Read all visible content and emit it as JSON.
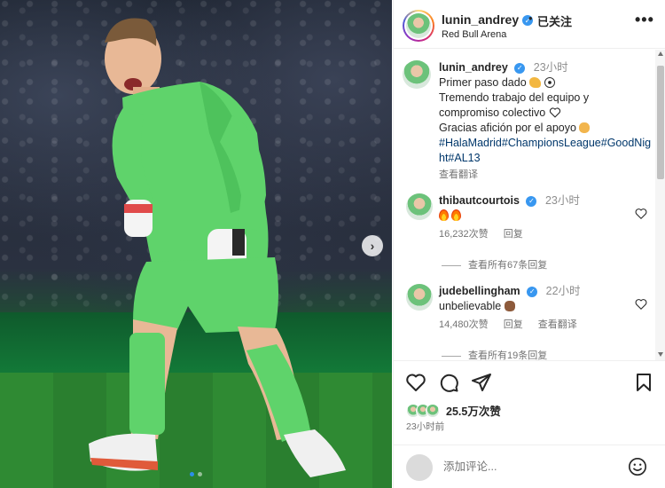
{
  "post": {
    "author": "lunin_andrey",
    "follow_label": "已关注",
    "separator": "•",
    "location": "Red Bull Arena",
    "more_label": "•••"
  },
  "caption": {
    "author": "lunin_andrey",
    "time": "23小时",
    "line1": "Primer paso dado",
    "line2": "Tremendo trabajo del equipo y compromiso colectivo",
    "line3": "Gracias afición por el apoyo",
    "hashtags": "#HalaMadrid#ChampionsLeague#GoodNight#AL13",
    "see_translation": "查看翻译"
  },
  "comments": [
    {
      "author": "thibautcourtois",
      "time": "23小时",
      "likes": "16,232次赞",
      "reply": "回复",
      "view_replies": "查看所有67条回复"
    },
    {
      "author": "judebellingham",
      "time": "22小时",
      "text": "unbelievable",
      "likes": "14,480次赞",
      "reply": "回复",
      "see_translation": "查看翻译",
      "view_replies": "查看所有19条回复"
    }
  ],
  "actions": {
    "likes_count": "25.5万次赞",
    "post_time": "23小时前"
  },
  "composer": {
    "placeholder": "添加评论..."
  },
  "colors": {
    "link": "#00376b",
    "verified": "#3897f0",
    "muted": "#737373",
    "jersey": "#5fd36b"
  },
  "icons": [
    "chevron-right-icon",
    "verified-icon",
    "more-icon",
    "heart-icon",
    "comment-icon",
    "share-icon",
    "bookmark-icon",
    "emoji-icon"
  ]
}
